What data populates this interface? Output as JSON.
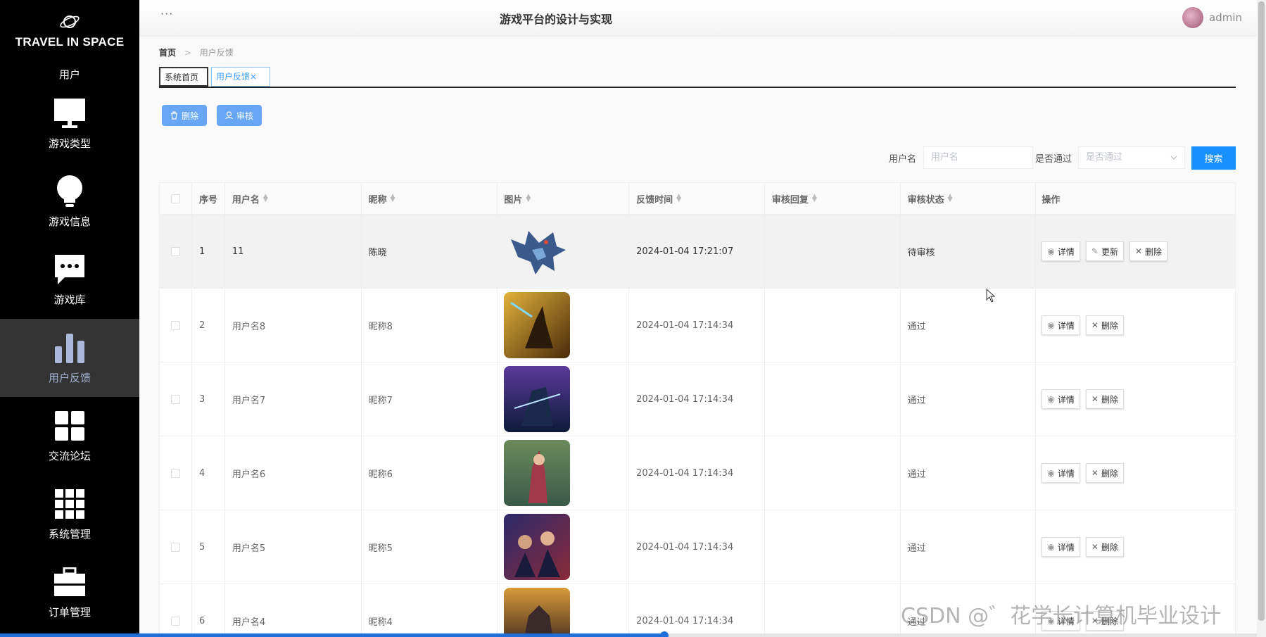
{
  "brand": {
    "name": "TRAVEL IN SPACE"
  },
  "sidebar": {
    "items": [
      {
        "label": "用户",
        "icon": "user-icon"
      },
      {
        "label": "游戏类型",
        "icon": "monitor-icon"
      },
      {
        "label": "游戏信息",
        "icon": "bulb-icon"
      },
      {
        "label": "游戏库",
        "icon": "chat-icon"
      },
      {
        "label": "用户反馈",
        "icon": "bar-chart-icon",
        "active": true
      },
      {
        "label": "交流论坛",
        "icon": "grid-icon"
      },
      {
        "label": "系统管理",
        "icon": "apps-icon"
      },
      {
        "label": "订单管理",
        "icon": "briefcase-icon"
      }
    ]
  },
  "header": {
    "dots": "···",
    "title": "游戏平台的设计与实现",
    "user": "admin"
  },
  "breadcrumb": {
    "home": "首页",
    "sep": ">",
    "current": "用户反馈"
  },
  "tabs": [
    {
      "label": "系统首页"
    },
    {
      "label": "用户反馈",
      "close": "×"
    }
  ],
  "toolbar": {
    "delete_label": "删除",
    "audit_label": "审核"
  },
  "filter": {
    "username_label": "用户名",
    "username_placeholder": "用户名",
    "passed_label": "是否通过",
    "passed_placeholder": "是否通过",
    "search_label": "搜索"
  },
  "table": {
    "headers": [
      "序号",
      "用户名",
      "昵称",
      "图片",
      "反馈时间",
      "审核回复",
      "审核状态",
      "操作"
    ],
    "rows": [
      {
        "idx": "1",
        "username": "11",
        "nickname": "陈晓",
        "time": "2024-01-04 17:21:07",
        "reply": "",
        "status": "待审核"
      },
      {
        "idx": "2",
        "username": "用户名8",
        "nickname": "昵称8",
        "time": "2024-01-04 17:14:34",
        "reply": "",
        "status": "通过"
      },
      {
        "idx": "3",
        "username": "用户名7",
        "nickname": "昵称7",
        "time": "2024-01-04 17:14:34",
        "reply": "",
        "status": "通过"
      },
      {
        "idx": "4",
        "username": "用户名6",
        "nickname": "昵称6",
        "time": "2024-01-04 17:14:34",
        "reply": "",
        "status": "通过"
      },
      {
        "idx": "5",
        "username": "用户名5",
        "nickname": "昵称5",
        "time": "2024-01-04 17:14:34",
        "reply": "",
        "status": "通过"
      },
      {
        "idx": "6",
        "username": "用户名4",
        "nickname": "昵称4",
        "time": "2024-01-04 17:14:34",
        "reply": "",
        "status": "通过"
      }
    ],
    "ops": {
      "detail": "详情",
      "update": "更新",
      "delete": "删除"
    }
  },
  "watermark": "CSDN @゛花学长计算机毕业设计",
  "colors": {
    "primary": "#1890ff",
    "sidebar_bg": "#000000",
    "active_bg": "#333333",
    "action_btn": "#66a6f2"
  }
}
